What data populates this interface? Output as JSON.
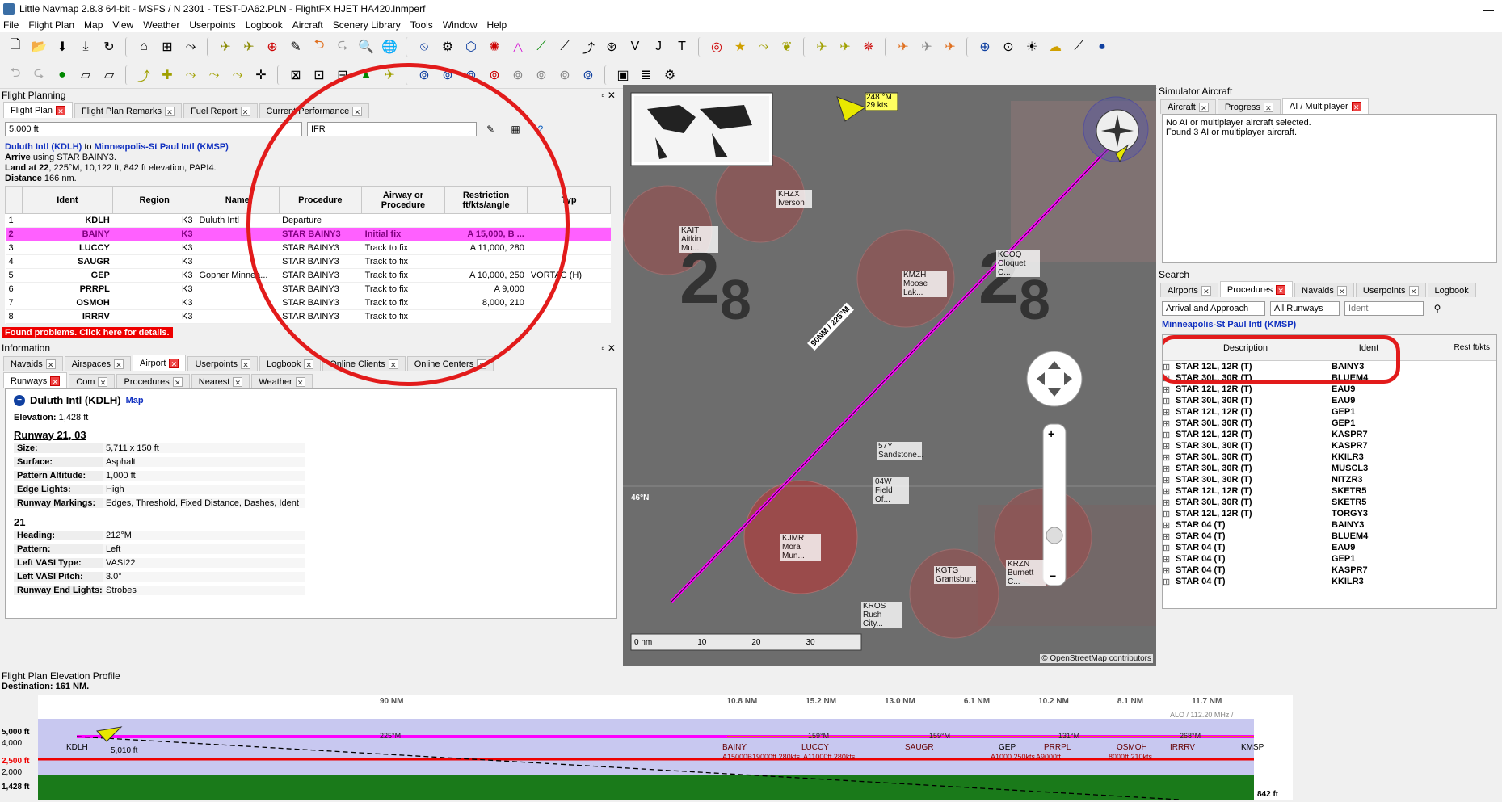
{
  "window": {
    "title": "Little Navmap 2.8.8 64-bit - MSFS / N 2301 - TEST-DA62.PLN - FlightFX HJET HA420.lnmperf",
    "minimize": "—"
  },
  "menu": [
    "File",
    "Flight Plan",
    "Map",
    "View",
    "Weather",
    "Userpoints",
    "Logbook",
    "Aircraft",
    "Scenery Library",
    "Tools",
    "Window",
    "Help"
  ],
  "flight_planning": {
    "title": "Flight Planning",
    "tabs": [
      "Flight Plan",
      "Flight Plan Remarks",
      "Fuel Report",
      "Current Performance"
    ],
    "altitude": "5,000 ft",
    "rule": "IFR",
    "route_from": "Duluth Intl (KDLH)",
    "route_to": "Minneapolis-St Paul Intl (KMSP)",
    "to_word": "to",
    "arrive": "Arrive",
    "arrive_text": "using STAR BAINY3.",
    "land": "Land at 22",
    "land_text": ", 225°M, 10,122 ft, 842 ft elevation, PAPI4.",
    "distance": "Distance",
    "distance_text": "166 nm.",
    "headers": [
      "",
      "Ident",
      "Region",
      "Name",
      "Procedure",
      "Airway or Procedure",
      "Restriction ft/kts/angle",
      "Typ"
    ],
    "rows": [
      [
        "1",
        "KDLH",
        "K3",
        "Duluth Intl",
        "Departure",
        "",
        "",
        ""
      ],
      [
        "2",
        "BAINY",
        "K3",
        "",
        "STAR BAINY3",
        "Initial fix",
        "A 15,000, B ...",
        ""
      ],
      [
        "3",
        "LUCCY",
        "K3",
        "",
        "STAR BAINY3",
        "Track to fix",
        "A 11,000, 280",
        ""
      ],
      [
        "4",
        "SAUGR",
        "K3",
        "",
        "STAR BAINY3",
        "Track to fix",
        "",
        ""
      ],
      [
        "5",
        "GEP",
        "K3",
        "Gopher Minnea...",
        "STAR BAINY3",
        "Track to fix",
        "A 10,000, 250",
        "VORTAC (H)"
      ],
      [
        "6",
        "PRRPL",
        "K3",
        "",
        "STAR BAINY3",
        "Track to fix",
        "A 9,000",
        ""
      ],
      [
        "7",
        "OSMOH",
        "K3",
        "",
        "STAR BAINY3",
        "Track to fix",
        "8,000, 210",
        ""
      ],
      [
        "8",
        "IRRRV",
        "K3",
        "",
        "STAR BAINY3",
        "Track to fix",
        "",
        ""
      ]
    ],
    "problems": "Found problems. Click here for details."
  },
  "information": {
    "title": "Information",
    "tabs": [
      "Navaids",
      "Airspaces",
      "Airport",
      "Userpoints",
      "Logbook",
      "Online Clients",
      "Online Centers"
    ],
    "subtabs": [
      "Runways",
      "Com",
      "Procedures",
      "Nearest",
      "Weather"
    ],
    "airport": "Duluth Intl (KDLH)",
    "map_link": "Map",
    "elevation_label": "Elevation:",
    "elevation": "1,428 ft",
    "runway_title": "Runway 21, 03",
    "runway_kv": [
      [
        "Size:",
        "5,711 x 150 ft"
      ],
      [
        "Surface:",
        "Asphalt"
      ],
      [
        "Pattern Altitude:",
        "1,000 ft"
      ],
      [
        "Edge Lights:",
        "High"
      ],
      [
        "Runway Markings:",
        "Edges, Threshold, Fixed Distance, Dashes, Ident"
      ]
    ],
    "end_title": "21",
    "end_kv": [
      [
        "Heading:",
        "212°M"
      ],
      [
        "Pattern:",
        "Left"
      ],
      [
        "Left VASI Type:",
        "VASI22"
      ],
      [
        "Left VASI Pitch:",
        "3.0°"
      ],
      [
        "Runway End Lights:",
        "Strobes"
      ]
    ]
  },
  "map": {
    "aircraft_label": "248 °M",
    "aircraft_label2": "29 kts",
    "route_label": "90NM / 225°M",
    "airports": [
      "KHZX Iverson",
      "KAIT Aitkin Mu...",
      "KMZH Moose Lak...",
      "KJMR Mora Mun...",
      "KGTG Grantsbur...",
      "KROS Rush City...",
      "KRZN Burnett C...",
      "KCOQ Cloquet C...",
      "57Y Sandstone...",
      "04W Field Of..."
    ],
    "scale": [
      "0 nm",
      "10",
      "20",
      "30"
    ],
    "grid_lat": "46°N",
    "copyright": "© OpenStreetMap contributors",
    "big_numbers": [
      "28",
      "28"
    ],
    "compass": "N"
  },
  "simulator": {
    "title": "Simulator Aircraft",
    "tabs": [
      "Aircraft",
      "Progress",
      "AI / Multiplayer"
    ],
    "line1": "No AI or multiplayer aircraft selected.",
    "line2": "Found 3 AI or multiplayer aircraft."
  },
  "search": {
    "title": "Search",
    "tabs": [
      "Airports",
      "Procedures",
      "Navaids",
      "Userpoints",
      "Logbook"
    ],
    "filter": "Arrival and Approach",
    "runways": "All Runways",
    "ident_placeholder": "Ident",
    "airport": "Minneapolis-St Paul Intl (KMSP)",
    "headers": [
      "Description",
      "Ident",
      "Rest ft/kts"
    ],
    "rows": [
      [
        "STAR 12L, 12R (T)",
        "BAINY3"
      ],
      [
        "STAR 30L, 30R (T)",
        "BLUEM4"
      ],
      [
        "STAR 12L, 12R (T)",
        "EAU9"
      ],
      [
        "STAR 30L, 30R (T)",
        "EAU9"
      ],
      [
        "STAR 12L, 12R (T)",
        "GEP1"
      ],
      [
        "STAR 30L, 30R (T)",
        "GEP1"
      ],
      [
        "STAR 12L, 12R (T)",
        "KASPR7"
      ],
      [
        "STAR 30L, 30R (T)",
        "KASPR7"
      ],
      [
        "STAR 30L, 30R (T)",
        "KKILR3"
      ],
      [
        "STAR 30L, 30R (T)",
        "MUSCL3"
      ],
      [
        "STAR 30L, 30R (T)",
        "NITZR3"
      ],
      [
        "STAR 12L, 12R (T)",
        "SKETR5"
      ],
      [
        "STAR 30L, 30R (T)",
        "SKETR5"
      ],
      [
        "STAR 12L, 12R (T)",
        "TORGY3"
      ],
      [
        "STAR 04 (T)",
        "BAINY3"
      ],
      [
        "STAR 04 (T)",
        "BLUEM4"
      ],
      [
        "STAR 04 (T)",
        "EAU9"
      ],
      [
        "STAR 04 (T)",
        "GEP1"
      ],
      [
        "STAR 04 (T)",
        "KASPR7"
      ],
      [
        "STAR 04 (T)",
        "KKILR3"
      ]
    ]
  },
  "profile": {
    "title": "Flight Plan Elevation Profile",
    "destination": "Destination: 161 NM.",
    "alt_labels": [
      "5,000 ft",
      "4,000",
      "2,500 ft",
      "2,000",
      "1,428 ft"
    ],
    "segments": [
      "90 NM",
      "10.8 NM",
      "15.2 NM",
      "13.0 NM",
      "6.1 NM",
      "10.2 NM",
      "8.1 NM",
      "11.7 NM"
    ],
    "waypoints": [
      "KDLH",
      "BAINY",
      "LUCCY",
      "SAUGR",
      "GEP",
      "PRRPL",
      "OSMOH",
      "IRRRV",
      "KMSP"
    ],
    "restrictions": [
      "A15000B19000ft 280kts",
      "A11000ft 280kts",
      "",
      "A1000 250kts",
      "A9000ft",
      "8000ft 210kts"
    ],
    "aircraft_alt": "5,010 ft",
    "end_elev": "842 ft",
    "ils": "ALO / 112.20 MHz /",
    "mag": [
      "225°M",
      "159°M",
      "159°M",
      "131°M",
      "268°M"
    ]
  },
  "colors": {
    "accent": "#ff00ff",
    "annotation": "#e21b1b",
    "map_bg": "#6b6b6b"
  }
}
